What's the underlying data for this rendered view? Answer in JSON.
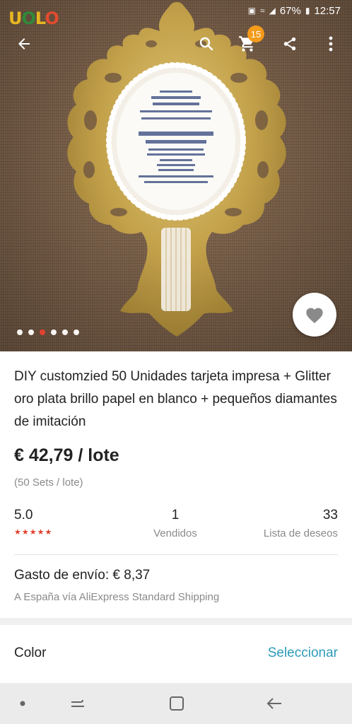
{
  "status_bar": {
    "battery": "67%",
    "time": "12:57",
    "icons": [
      "notification-icon",
      "wifi-icon",
      "signal-icon",
      "battery-icon"
    ]
  },
  "watermark": {
    "text": "UOLO"
  },
  "toolbar": {
    "back_icon": "arrow-left-icon",
    "search_icon": "search-icon",
    "cart_icon": "cart-icon",
    "cart_count": "15",
    "share_icon": "share-icon",
    "more_icon": "more-vertical-icon"
  },
  "gallery": {
    "total": 6,
    "active_index": 2,
    "favorite_icon": "heart-icon"
  },
  "product": {
    "title": "DIY customzied 50 Unidades tarjeta impresa + Glitter oro plata brillo papel en blanco + pequeños diamantes de imitación",
    "price": "€ 42,79 / lote",
    "unit_info": "(50 Sets / lote)"
  },
  "stats": {
    "rating": "5.0",
    "stars": "★★★★★",
    "sold_value": "1",
    "sold_label": "Vendidos",
    "wishlist_value": "33",
    "wishlist_label": "Lista de deseos"
  },
  "shipping": {
    "title": "Gasto de envío: € 8,37",
    "subtitle": "A España vía AliExpress Standard Shipping"
  },
  "options": {
    "color_label": "Color",
    "select_label": "Seleccionar"
  },
  "navbar": {
    "icons": [
      "home-dot-icon",
      "recents-icon",
      "overview-icon",
      "back-nav-icon"
    ]
  },
  "colors": {
    "accent": "#e3402f",
    "link": "#2e9bb8",
    "badge": "#f39b1a"
  }
}
